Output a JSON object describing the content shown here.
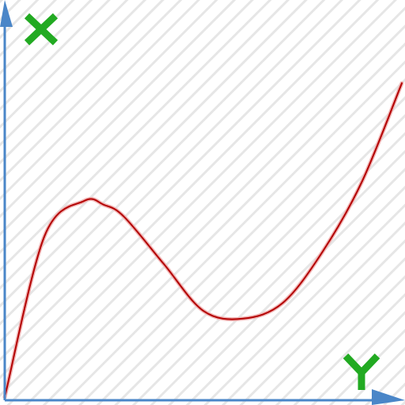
{
  "colors": {
    "background": "#ffffff",
    "hatch": "#e6e6e6",
    "axis": "#4a86c8",
    "curve": "#b30000",
    "curve_glow": "#f0b4b4",
    "axis_glyph": "#22aa22"
  },
  "axes": {
    "x_axis_glyph": "Y",
    "y_axis_glyph": "X",
    "x_axis_glyph_icon": "y-letter-icon",
    "y_axis_glyph_icon": "x-cross-icon"
  },
  "chart_data": {
    "type": "line",
    "title": "",
    "xlabel": "",
    "ylabel": "",
    "xlim": [
      0,
      1
    ],
    "ylim": [
      0,
      1
    ],
    "grid": false,
    "legend": "none",
    "background_pattern": "diagonal-hatch",
    "series": [
      {
        "x": [
          0,
          0.1,
          0.2,
          0.25,
          0.3,
          0.4,
          0.5,
          0.6,
          0.7,
          0.8,
          0.9,
          1.0
        ],
        "y": [
          0,
          0.41,
          0.5,
          0.49,
          0.46,
          0.34,
          0.22,
          0.2,
          0.24,
          0.37,
          0.55,
          0.8
        ]
      }
    ]
  }
}
